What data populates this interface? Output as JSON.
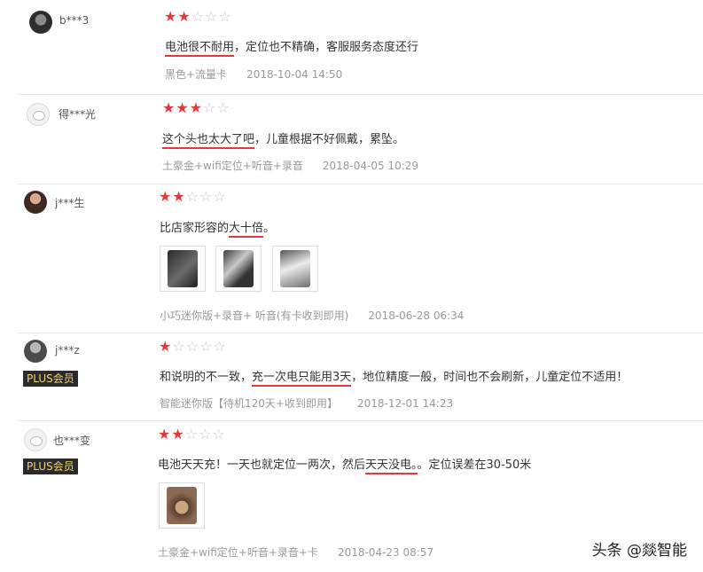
{
  "colors": {
    "accent": "#e4393c",
    "meta": "#999999",
    "plus_bg": "#2b2b2b",
    "plus_fg": "#f2d36a"
  },
  "reviews": [
    {
      "user": "b***3",
      "avatar_icon": "dark-avatar-icon",
      "plus": null,
      "rating": 2,
      "content": {
        "underlined": "电池很不耐用",
        "rest": "，定位也不精确，客服服务态度还行"
      },
      "variant": "黑色+流量卡",
      "date": "2018-10-04 14:50"
    },
    {
      "user": "得***光",
      "avatar_icon": "default-avatar-icon",
      "plus": null,
      "rating": 3,
      "content": {
        "underlined": "这个头也太大了吧",
        "rest": "，儿童根据不好佩戴，累坠。"
      },
      "variant": "土豪金+wifi定位+听音+录音",
      "date": "2018-04-05 10:29"
    },
    {
      "user": "j***生",
      "avatar_icon": "photo-avatar-icon",
      "plus": null,
      "rating": 2,
      "content": {
        "before": "比店家形容的",
        "underlined": "大十倍",
        "after": "。"
      },
      "images": [
        "review-photo-icon",
        "review-photo-icon",
        "review-photo-icon"
      ],
      "variant": "小巧迷你版+录音+ 听音(有卡收到即用)",
      "date": "2018-06-28 06:34"
    },
    {
      "user": "j***z",
      "avatar_icon": "photo-avatar-icon",
      "plus": "PLUS会员",
      "rating": 1,
      "content": {
        "before": "和说明的不一致，",
        "underlined": "充一次电只能用3天",
        "after": "，地位精度一般，时间也不会刷新，儿童定位不适用！"
      },
      "variant": "智能迷你版【待机120天+收到即用】",
      "date": "2018-12-01 14:23"
    },
    {
      "user": "也***变",
      "avatar_icon": "default-avatar-icon",
      "plus": "PLUS会员",
      "rating": 2,
      "content": {
        "before": "电池天天充！一天也就定位一两次，然后",
        "underlined": "天天没电。",
        "after": "。定位误差在30-50米"
      },
      "images": [
        "review-photo-icon"
      ],
      "variant": "土豪金+wifi定位+听音+录音+卡",
      "date": "2018-04-23 08:57"
    }
  ],
  "watermark": "头条 @燚智能"
}
